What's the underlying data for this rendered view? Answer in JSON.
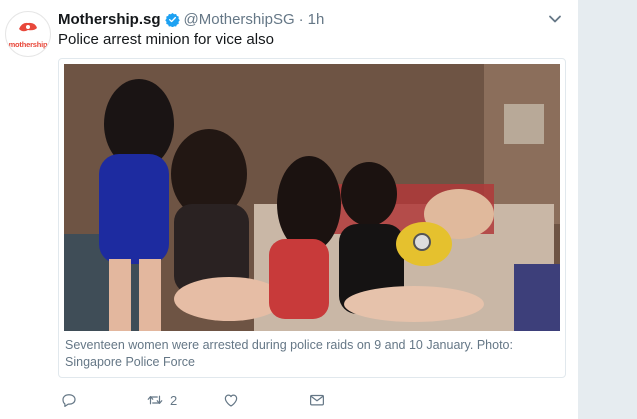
{
  "tweet": {
    "display_name": "Mothership.sg",
    "handle": "@MothershipSG",
    "separator": "·",
    "time": "1h",
    "text": "Police arrest minion for vice also",
    "avatar_text": "mothership",
    "icons": {
      "verified": "verified-badge-icon",
      "caret": "chevron-down-icon"
    }
  },
  "card": {
    "caption": "Seventeen women were arrested during police raids on 9 and 10 January. Photo: Singapore Police Force"
  },
  "actions": {
    "reply_count": "",
    "retweet_count": "2",
    "like_count": "",
    "icons": [
      "reply-icon",
      "retweet-icon",
      "like-icon",
      "direct-message-icon"
    ]
  },
  "colors": {
    "brand": "#e8483b",
    "verified": "#1da1f2",
    "muted": "#657786",
    "background": "#e6ecf0"
  }
}
